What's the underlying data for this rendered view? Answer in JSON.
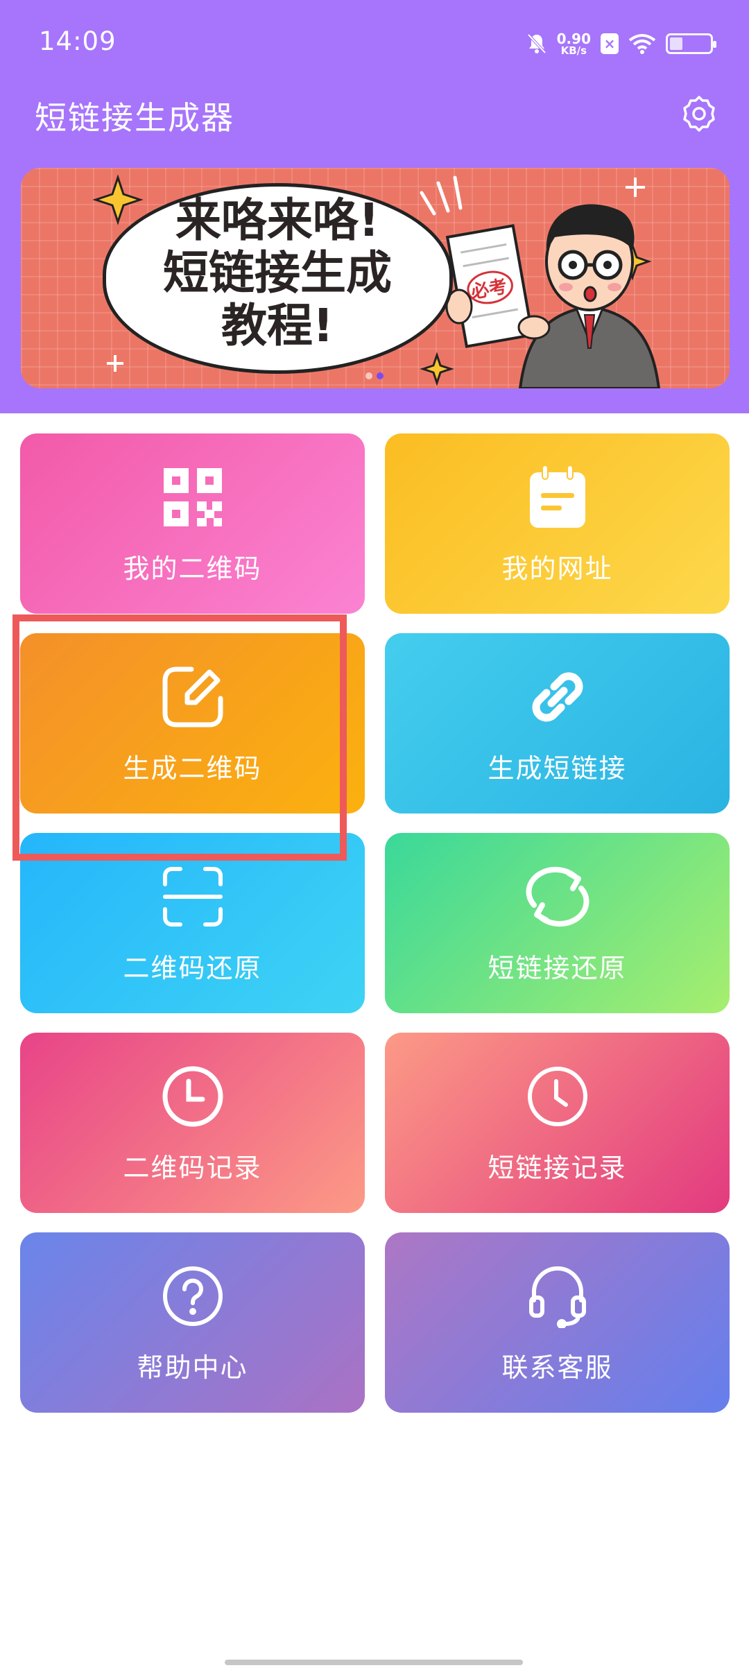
{
  "status_bar": {
    "time": "14:09",
    "net_speed_value": "0.90",
    "net_speed_unit": "KB/s",
    "icons": [
      "bell-muted-icon",
      "notification-box-icon",
      "wifi-icon",
      "battery-icon"
    ]
  },
  "header": {
    "title": "短链接生成器",
    "settings_icon": "gear-icon"
  },
  "banner": {
    "line1": "来咯来咯!",
    "line2": "短链接生成",
    "line3": "教程!",
    "paper_text": "必考"
  },
  "menu": {
    "items": [
      {
        "label": "我的二维码",
        "icon": "qr-code-icon",
        "color_from": "#f25aa8",
        "color_to": "#fb83d2"
      },
      {
        "label": "我的网址",
        "icon": "notepad-icon",
        "color_from": "#fbbd22",
        "color_to": "#fdd84b"
      },
      {
        "label": "生成二维码",
        "icon": "edit-icon",
        "color_from": "#f4902a",
        "color_to": "#fbb10e"
      },
      {
        "label": "生成短链接",
        "icon": "link-icon",
        "color_from": "#44cdee",
        "color_to": "#2ab3e2"
      },
      {
        "label": "二维码还原",
        "icon": "scan-icon",
        "color_from": "#25b6fb",
        "color_to": "#3ed3f4"
      },
      {
        "label": "短链接还原",
        "icon": "refresh-icon",
        "color_from": "#3ad89a",
        "color_to": "#a7ee6e"
      },
      {
        "label": "二维码记录",
        "icon": "clock-icon",
        "color_from": "#e84488",
        "color_to": "#fc9a86"
      },
      {
        "label": "短链接记录",
        "icon": "clock-icon",
        "color_from": "#fc9a86",
        "color_to": "#e23a7f"
      },
      {
        "label": "帮助中心",
        "icon": "help-icon",
        "color_from": "#6a85ea",
        "color_to": "#aa72c4"
      },
      {
        "label": "联系客服",
        "icon": "headset-icon",
        "color_from": "#ad77c4",
        "color_to": "#657fec"
      }
    ]
  }
}
